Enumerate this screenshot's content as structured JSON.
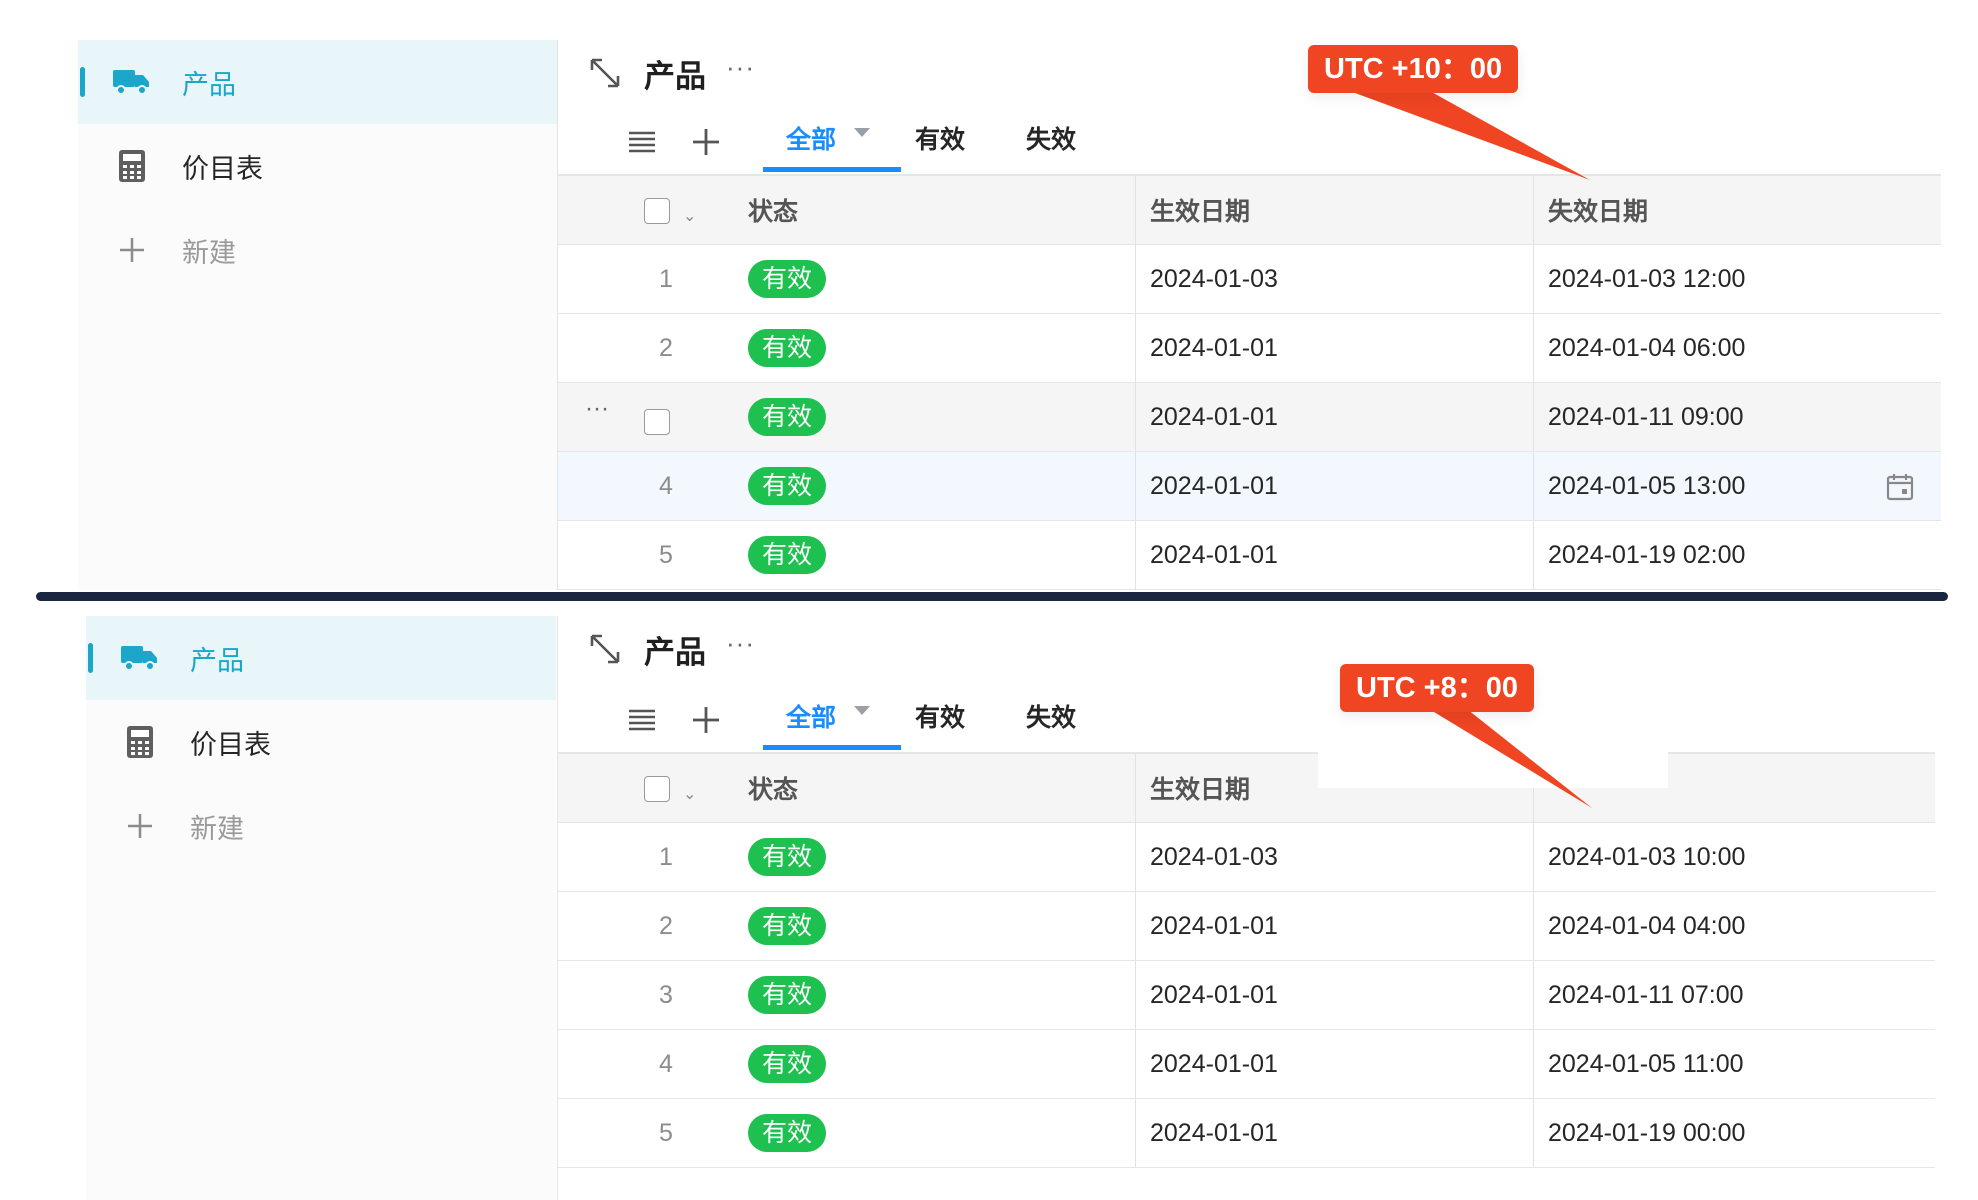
{
  "top": {
    "sidebar": {
      "items": [
        {
          "label": "产品",
          "icon": "truck-icon",
          "active": true
        },
        {
          "label": "价目表",
          "icon": "calculator-icon"
        },
        {
          "label": "新建",
          "icon": "plus-icon"
        }
      ]
    },
    "title": "产品",
    "more": "···",
    "tabs": [
      "全部",
      "有效",
      "失效"
    ],
    "columns": {
      "status": "状态",
      "effective": "生效日期",
      "expiry": "失效日期"
    },
    "rows": [
      {
        "num": "1",
        "status": "有效",
        "effective": "2024-01-03",
        "expiry": "2024-01-03 12:00"
      },
      {
        "num": "2",
        "status": "有效",
        "effective": "2024-01-01",
        "expiry": "2024-01-04 06:00"
      },
      {
        "num": "",
        "status": "有效",
        "effective": "2024-01-01",
        "expiry": "2024-01-11 09:00"
      },
      {
        "num": "4",
        "status": "有效",
        "effective": "2024-01-01",
        "expiry": "2024-01-05 13:00"
      },
      {
        "num": "5",
        "status": "有效",
        "effective": "2024-01-01",
        "expiry": "2024-01-19 02:00"
      }
    ],
    "callout": "UTC +10：00"
  },
  "bottom": {
    "sidebar": {
      "items": [
        {
          "label": "产品",
          "icon": "truck-icon",
          "active": true
        },
        {
          "label": "价目表",
          "icon": "calculator-icon"
        },
        {
          "label": "新建",
          "icon": "plus-icon"
        }
      ]
    },
    "title": "产品",
    "more": "···",
    "tabs": [
      "全部",
      "有效",
      "失效"
    ],
    "columns": {
      "status": "状态",
      "effective": "生效日期"
    },
    "rows": [
      {
        "num": "1",
        "status": "有效",
        "effective": "2024-01-03",
        "expiry": "2024-01-03 10:00"
      },
      {
        "num": "2",
        "status": "有效",
        "effective": "2024-01-01",
        "expiry": "2024-01-04 04:00"
      },
      {
        "num": "3",
        "status": "有效",
        "effective": "2024-01-01",
        "expiry": "2024-01-11 07:00"
      },
      {
        "num": "4",
        "status": "有效",
        "effective": "2024-01-01",
        "expiry": "2024-01-05 11:00"
      },
      {
        "num": "5",
        "status": "有效",
        "effective": "2024-01-01",
        "expiry": "2024-01-19 00:00"
      }
    ],
    "callout": "UTC +8：00"
  },
  "colors": {
    "accent": "#1aa7c9",
    "tab_active": "#1a8cff",
    "badge": "#1ec150",
    "callout": "#ef4522",
    "divider": "#1a2640"
  }
}
